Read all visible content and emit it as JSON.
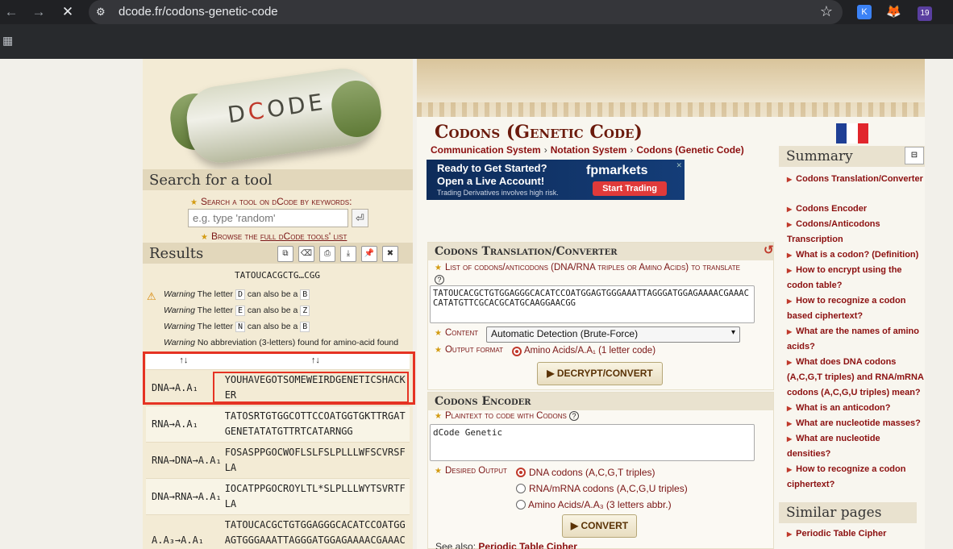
{
  "browser": {
    "url": "dcode.fr/codons-genetic-code",
    "ext_badge": "19"
  },
  "left": {
    "search_heading": "Search for a tool",
    "search_label": "Search a tool on dCode by keywords:",
    "search_placeholder": "e.g. type 'random'",
    "browse_prefix": "Browse the",
    "browse_link": "full dCode tools' list",
    "results_heading": "Results",
    "input_chip": "TATOUCACGCTG…CGG",
    "warnings": [
      {
        "label": "Warning",
        "pre": "The letter",
        "a": "D",
        "mid": "can also be a",
        "b": "B"
      },
      {
        "label": "Warning",
        "pre": "The letter",
        "a": "E",
        "mid": "can also be a",
        "b": "Z"
      },
      {
        "label": "Warning",
        "pre": "The letter",
        "a": "N",
        "mid": "can also be a",
        "b": "B"
      }
    ],
    "warning_last_label": "Warning",
    "warning_last_text": "No abbreviation (3-letters) found for amino-acid found",
    "sort_col1": "↑↓",
    "sort_col2": "↑↓",
    "results": [
      {
        "label": "DNA→A.A₁",
        "value": "YOUHAVEGOTSOMEWEIRDGENETICSHACKER"
      },
      {
        "label": "RNA→A.A₁",
        "value": "TATOSRTGTGGCOTTCCOATGGTGKTTRGATGENETATATGTTRTCATARNGG"
      },
      {
        "label": "RNA→DNA→A.A₁",
        "value": "FOSASPPGOCWOFLSLFSLPLLLWFSCVRSFLA"
      },
      {
        "label": "DNA→RNA→A.A₁",
        "value": "IOCATPPGOCROYLTL*SLPLLLWYTSVRTFLA"
      },
      {
        "label": "A.A₃→A.A₁",
        "value": "TATOUCACGCTGTGGAGGGCACATCCOATGGAGTGGGAAATTAGGGATGGAGAAAACGAAACCATATGTTCGCACGCATGCAAGGAACGG"
      }
    ]
  },
  "center": {
    "title": "Codons (Genetic Code)",
    "breadcrumbs": [
      "Communication System",
      "Notation System",
      "Codons (Genetic Code)"
    ],
    "ad": {
      "line1": "Ready to Get Started?",
      "line2": "Open a Live Account!",
      "line3": "Trading Derivatives involves high risk.",
      "brand": "fpmarkets",
      "cta": "Start Trading"
    },
    "translator": {
      "heading": "Codons Translation/Converter",
      "list_label": "List of codons/anticodons (DNA/RNA triples or Amino Acids) to translate",
      "input_value": "TATOUCACGCTGTGGAGGGCACATCCOATGGAGTGGGAAATTAGGGATGGAGAAAACGAAACCATATGTTCGCACGCATGCAAGGAACGG",
      "content_label": "Content",
      "content_value": "Automatic Detection (Brute-Force)",
      "output_label": "Output format",
      "output_option": "Amino Acids/A.A₁ (1 letter code)",
      "button": "▶ DECRYPT/CONVERT"
    },
    "encoder": {
      "heading": "Codons Encoder",
      "plain_label": "Plaintext to code with Codons",
      "plain_value": "dCode Genetic",
      "desired_label": "Desired Output",
      "options": [
        "DNA codons (A,C,G,T triples)",
        "RNA/mRNA codons (A,C,G,U triples)",
        "Amino Acids/A.A₃ (3 letters abbr.)"
      ],
      "button": "▶ CONVERT",
      "see_also_label": "See also:",
      "see_also_link": "Periodic Table Cipher"
    }
  },
  "summary": {
    "title": "Summary",
    "toggle": "⊟",
    "items": [
      "Codons Translation/Converter",
      "Codons Encoder",
      "Codons/Anticodons Transcription",
      "What is a codon? (Definition)",
      "How to encrypt using the codon table?",
      "How to recognize a codon based ciphertext?",
      "What are the names of amino acids?",
      "What does DNA codons (A,C,G,T triples) and RNA/mRNA codons (A,C,G,U triples) mean?",
      "What is an anticodon?",
      "What are nucleotide masses?",
      "What are nucleotide densities?",
      "How to recognize a codon ciphertext?"
    ],
    "similar_title": "Similar pages",
    "similar_items": [
      "Periodic Table Cipher"
    ]
  }
}
